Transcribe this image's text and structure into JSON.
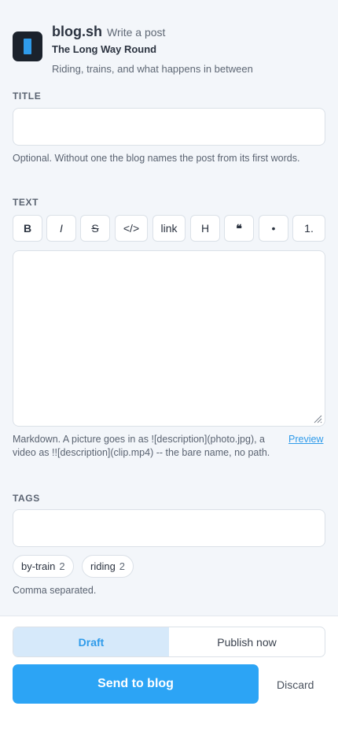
{
  "header": {
    "brand": "blog.sh",
    "subtitle": "Write a post",
    "blog_title": "The Long Way Round",
    "blog_tagline": "Riding, trains, and what happens in between"
  },
  "title_field": {
    "label": "TITLE",
    "value": "",
    "help": "Optional. Without one the blog names the post from its first words."
  },
  "text_field": {
    "label": "TEXT",
    "value": "",
    "toolbar": [
      {
        "name": "bold",
        "label": "B"
      },
      {
        "name": "italic",
        "label": "I"
      },
      {
        "name": "strike",
        "label": "S"
      },
      {
        "name": "code",
        "label": "</>"
      },
      {
        "name": "link",
        "label": "link"
      },
      {
        "name": "heading",
        "label": "H"
      },
      {
        "name": "quote",
        "label": "❝"
      },
      {
        "name": "bullet-list",
        "label": "•"
      },
      {
        "name": "numbered-list",
        "label": "1."
      }
    ],
    "help": "Markdown. A picture goes in as ![description](photo.jpg), a video as !![description](clip.mp4) -- the bare name, no path.",
    "preview_label": "Preview"
  },
  "tags_field": {
    "label": "TAGS",
    "value": "",
    "suggestions": [
      {
        "name": "by-train",
        "count": "2"
      },
      {
        "name": "riding",
        "count": "2"
      }
    ],
    "help": "Comma separated."
  },
  "footer": {
    "mode_draft": "Draft",
    "mode_publish": "Publish now",
    "send_label": "Send to blog",
    "discard_label": "Discard"
  },
  "colors": {
    "accent": "#2ca4f5",
    "draft_bg": "#d6e9fa",
    "page_bg": "#f3f6fa"
  }
}
